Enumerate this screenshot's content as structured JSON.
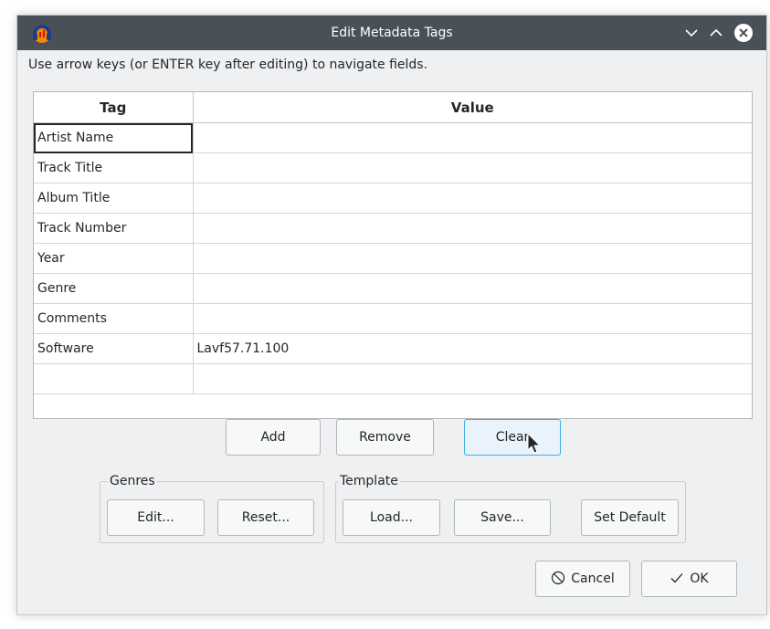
{
  "window": {
    "title": "Edit Metadata Tags"
  },
  "instructions": "Use arrow keys (or ENTER key after editing) to navigate fields.",
  "table": {
    "headers": [
      "Tag",
      "Value"
    ],
    "rows": [
      {
        "tag": "Artist Name",
        "value": ""
      },
      {
        "tag": "Track Title",
        "value": ""
      },
      {
        "tag": "Album Title",
        "value": ""
      },
      {
        "tag": "Track Number",
        "value": ""
      },
      {
        "tag": "Year",
        "value": ""
      },
      {
        "tag": "Genre",
        "value": ""
      },
      {
        "tag": "Comments",
        "value": ""
      },
      {
        "tag": "Software",
        "value": "Lavf57.71.100"
      },
      {
        "tag": "",
        "value": ""
      }
    ]
  },
  "buttons": {
    "add": "Add",
    "remove": "Remove",
    "clear": "Clear"
  },
  "genres": {
    "legend": "Genres",
    "edit": "Edit...",
    "reset": "Reset..."
  },
  "template": {
    "legend": "Template",
    "load": "Load...",
    "save": "Save...",
    "set_default": "Set Default"
  },
  "dialog": {
    "cancel": "Cancel",
    "ok": "OK"
  },
  "icons": {
    "app": "audacity-icon",
    "minimize": "chevron-down-icon",
    "maximize": "chevron-up-icon",
    "close": "close-icon",
    "cancel": "cancel-icon",
    "ok": "checkmark-icon"
  },
  "colors": {
    "titlebar": "#4a5058",
    "window_bg": "#eff0f1",
    "accent": "#3daee9"
  }
}
